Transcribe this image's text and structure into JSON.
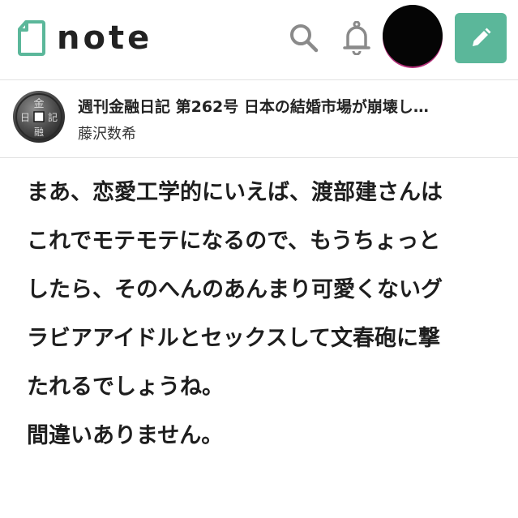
{
  "header": {
    "logo_text": "note",
    "logo_icon": "note-logo-icon",
    "search_icon": "search-icon",
    "notification_icon": "bell-icon",
    "avatar": "redacted-avatar",
    "compose_icon": "pencil-icon",
    "accent_color": "#5bb79a"
  },
  "article": {
    "title": "週刊金融日記 第262号 日本の結婚市場が崩壊し…",
    "author": "藤沢数希",
    "avatar": "coin-avatar",
    "avatar_chars": [
      "金",
      "記",
      "日",
      "融"
    ]
  },
  "body": {
    "lines": [
      "まあ、恋愛工学的にいえば、渡部建さんは",
      "これでモテモテになるので、もうちょっと",
      "したら、そのへんのあんまり可愛くないグ",
      "ラビアアイドルとセックスして文春砲に撃",
      "たれるでしょうね。",
      "間違いありません。"
    ]
  }
}
